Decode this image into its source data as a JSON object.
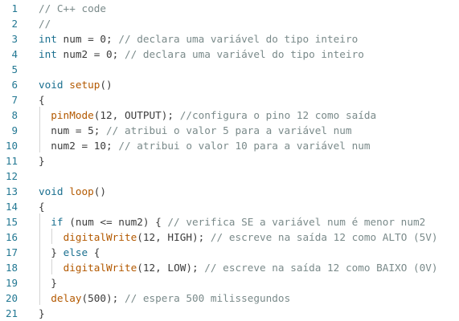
{
  "colors": {
    "background": "#ffffff",
    "line_number": "#237893",
    "keyword": "#1a6f8f",
    "function": "#b35900",
    "comment": "#7a8a8a",
    "plain": "#3b3b3b"
  },
  "editor": {
    "lines": [
      {
        "number": "1",
        "tokens": [
          {
            "text": "// C++ code",
            "kind": "comment"
          }
        ]
      },
      {
        "number": "2",
        "tokens": [
          {
            "text": "//",
            "kind": "comment"
          }
        ]
      },
      {
        "number": "3",
        "tokens": [
          {
            "text": "int",
            "kind": "keyword"
          },
          {
            "text": " num = 0; ",
            "kind": "plain"
          },
          {
            "text": "// declara uma variável do tipo inteiro",
            "kind": "comment"
          }
        ]
      },
      {
        "number": "4",
        "tokens": [
          {
            "text": "int",
            "kind": "keyword"
          },
          {
            "text": " num2 = 0; ",
            "kind": "plain"
          },
          {
            "text": "// declara uma variável do tipo inteiro",
            "kind": "comment"
          }
        ]
      },
      {
        "number": "5",
        "tokens": []
      },
      {
        "number": "6",
        "tokens": [
          {
            "text": "void",
            "kind": "keyword"
          },
          {
            "text": " ",
            "kind": "plain"
          },
          {
            "text": "setup",
            "kind": "func"
          },
          {
            "text": "()",
            "kind": "plain"
          }
        ]
      },
      {
        "number": "7",
        "tokens": [
          {
            "text": "{",
            "kind": "plain"
          }
        ]
      },
      {
        "number": "8",
        "tokens": [
          {
            "text": "  ",
            "kind": "plain"
          },
          {
            "text": "pinMode",
            "kind": "func"
          },
          {
            "text": "(12, OUTPUT); ",
            "kind": "plain"
          },
          {
            "text": "//configura o pino 12 como saída",
            "kind": "comment"
          }
        ]
      },
      {
        "number": "9",
        "tokens": [
          {
            "text": "  num = 5; ",
            "kind": "plain"
          },
          {
            "text": "// atribui o valor 5 para a variável num",
            "kind": "comment"
          }
        ]
      },
      {
        "number": "10",
        "tokens": [
          {
            "text": "  num2 = 10; ",
            "kind": "plain"
          },
          {
            "text": "// atribui o valor 10 para a variável num",
            "kind": "comment"
          }
        ]
      },
      {
        "number": "11",
        "tokens": [
          {
            "text": "}",
            "kind": "plain"
          }
        ]
      },
      {
        "number": "12",
        "tokens": []
      },
      {
        "number": "13",
        "tokens": [
          {
            "text": "void",
            "kind": "keyword"
          },
          {
            "text": " ",
            "kind": "plain"
          },
          {
            "text": "loop",
            "kind": "func"
          },
          {
            "text": "()",
            "kind": "plain"
          }
        ]
      },
      {
        "number": "14",
        "tokens": [
          {
            "text": "{",
            "kind": "plain"
          }
        ]
      },
      {
        "number": "15",
        "tokens": [
          {
            "text": "  ",
            "kind": "plain"
          },
          {
            "text": "if",
            "kind": "keyword"
          },
          {
            "text": " (num <= num2) { ",
            "kind": "plain"
          },
          {
            "text": "// verifica SE a variável num é menor num2",
            "kind": "comment"
          }
        ]
      },
      {
        "number": "16",
        "tokens": [
          {
            "text": "    ",
            "kind": "plain"
          },
          {
            "text": "digitalWrite",
            "kind": "func"
          },
          {
            "text": "(12, HIGH); ",
            "kind": "plain"
          },
          {
            "text": "// escreve na saída 12 como ALTO (5V)",
            "kind": "comment"
          }
        ]
      },
      {
        "number": "17",
        "tokens": [
          {
            "text": "  } ",
            "kind": "plain"
          },
          {
            "text": "else",
            "kind": "keyword"
          },
          {
            "text": " {",
            "kind": "plain"
          }
        ]
      },
      {
        "number": "18",
        "tokens": [
          {
            "text": "    ",
            "kind": "plain"
          },
          {
            "text": "digitalWrite",
            "kind": "func"
          },
          {
            "text": "(12, LOW); ",
            "kind": "plain"
          },
          {
            "text": "// escreve na saída 12 como BAIXO (0V)",
            "kind": "comment"
          }
        ]
      },
      {
        "number": "19",
        "tokens": [
          {
            "text": "  }",
            "kind": "plain"
          }
        ]
      },
      {
        "number": "20",
        "tokens": [
          {
            "text": "  ",
            "kind": "plain"
          },
          {
            "text": "delay",
            "kind": "func"
          },
          {
            "text": "(500); ",
            "kind": "plain"
          },
          {
            "text": "// espera 500 milissegundos",
            "kind": "comment"
          }
        ]
      },
      {
        "number": "21",
        "tokens": [
          {
            "text": "}",
            "kind": "plain"
          }
        ]
      }
    ]
  }
}
